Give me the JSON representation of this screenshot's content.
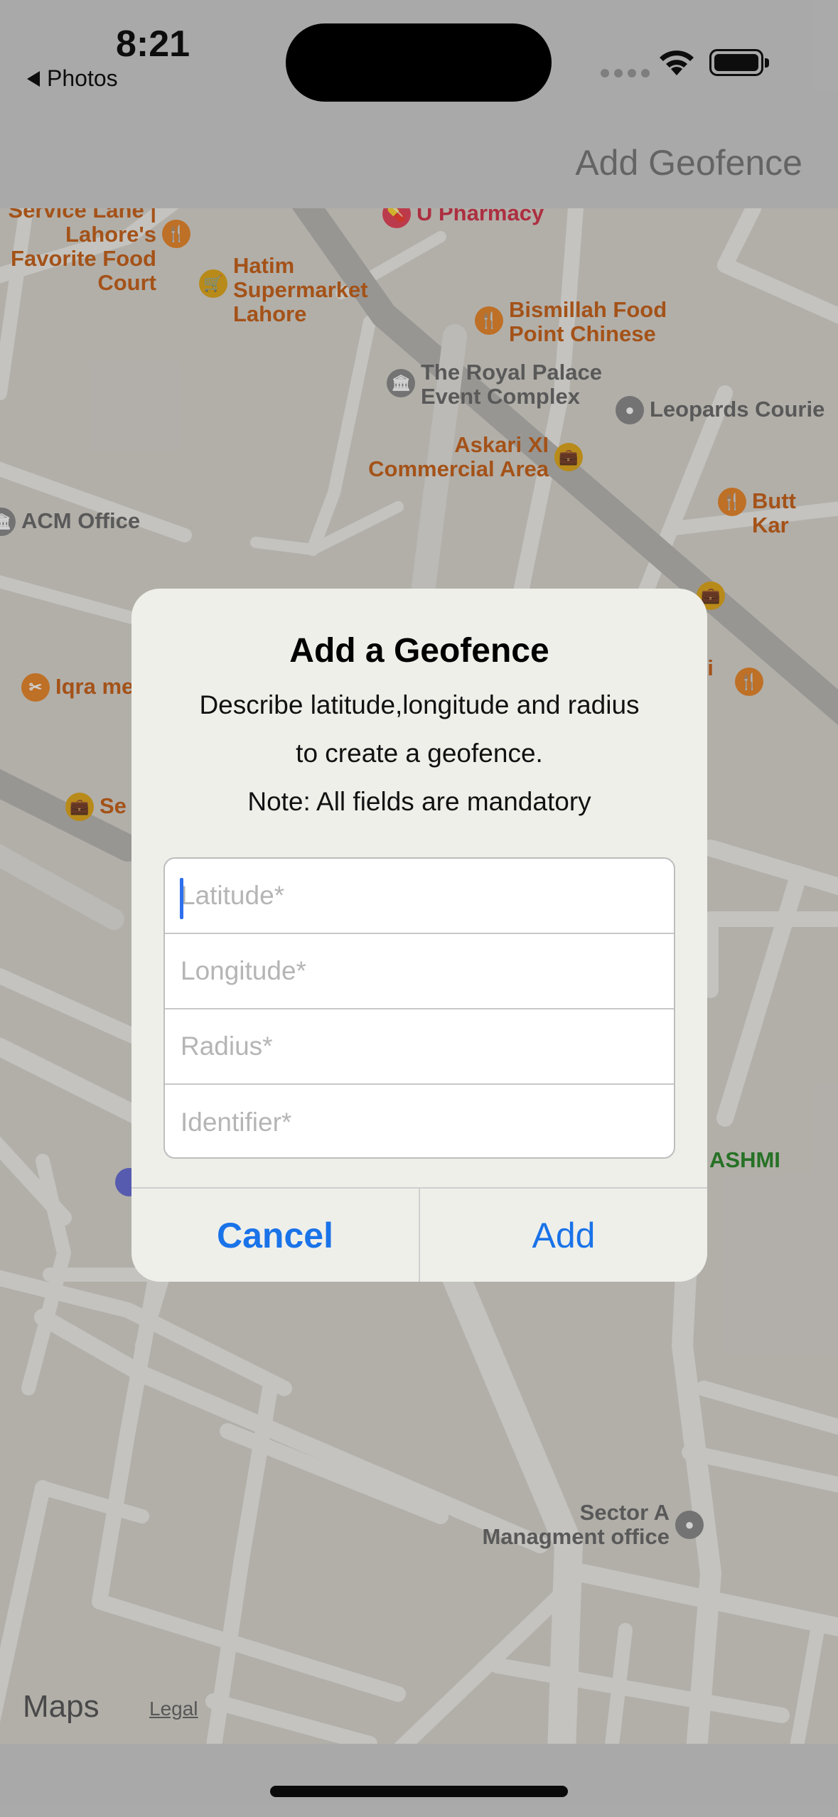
{
  "status_bar": {
    "time": "8:21",
    "back_app": "Photos"
  },
  "nav": {
    "right_button": "Add Geofence"
  },
  "map": {
    "pois": [
      {
        "name": "Service Lane | Lahore's Favorite Food Court",
        "kind": "food"
      },
      {
        "name": "Hatim Supermarket Lahore",
        "kind": "shop"
      },
      {
        "name": "U Pharmacy",
        "kind": "pharmacy"
      },
      {
        "name": "Bismillah Food Point Chinese",
        "kind": "food"
      },
      {
        "name": "The Royal Palace Event Complex",
        "kind": "venue"
      },
      {
        "name": "Leopards Courie",
        "kind": "generic"
      },
      {
        "name": "Askari XI Commercial Area",
        "kind": "shop"
      },
      {
        "name": "ACM Office",
        "kind": "government"
      },
      {
        "name": "Butt Kar",
        "kind": "food"
      },
      {
        "name": "Iqra me",
        "kind": "food"
      },
      {
        "name": "Se",
        "kind": "shop"
      },
      {
        "name": "ari nt",
        "kind": "food"
      },
      {
        "name": "ASHMI",
        "kind": "park"
      },
      {
        "name": "Sector A Managment office",
        "kind": "generic"
      }
    ],
    "attribution": "Maps",
    "legal": "Legal"
  },
  "alert": {
    "title": "Add a Geofence",
    "message_line1": "Describe latitude,longitude and radius",
    "message_line2": "to create a geofence.",
    "message_line3": "Note: All fields are mandatory",
    "fields": [
      {
        "placeholder": "Latitude*",
        "value": ""
      },
      {
        "placeholder": "Longitude*",
        "value": ""
      },
      {
        "placeholder": "Radius*",
        "value": ""
      },
      {
        "placeholder": "Identifier*",
        "value": ""
      }
    ],
    "cancel_label": "Cancel",
    "add_label": "Add"
  },
  "colors": {
    "accent": "#1a73e8",
    "poi_orange": "#c8641e",
    "poi_red": "#d23a4f"
  }
}
